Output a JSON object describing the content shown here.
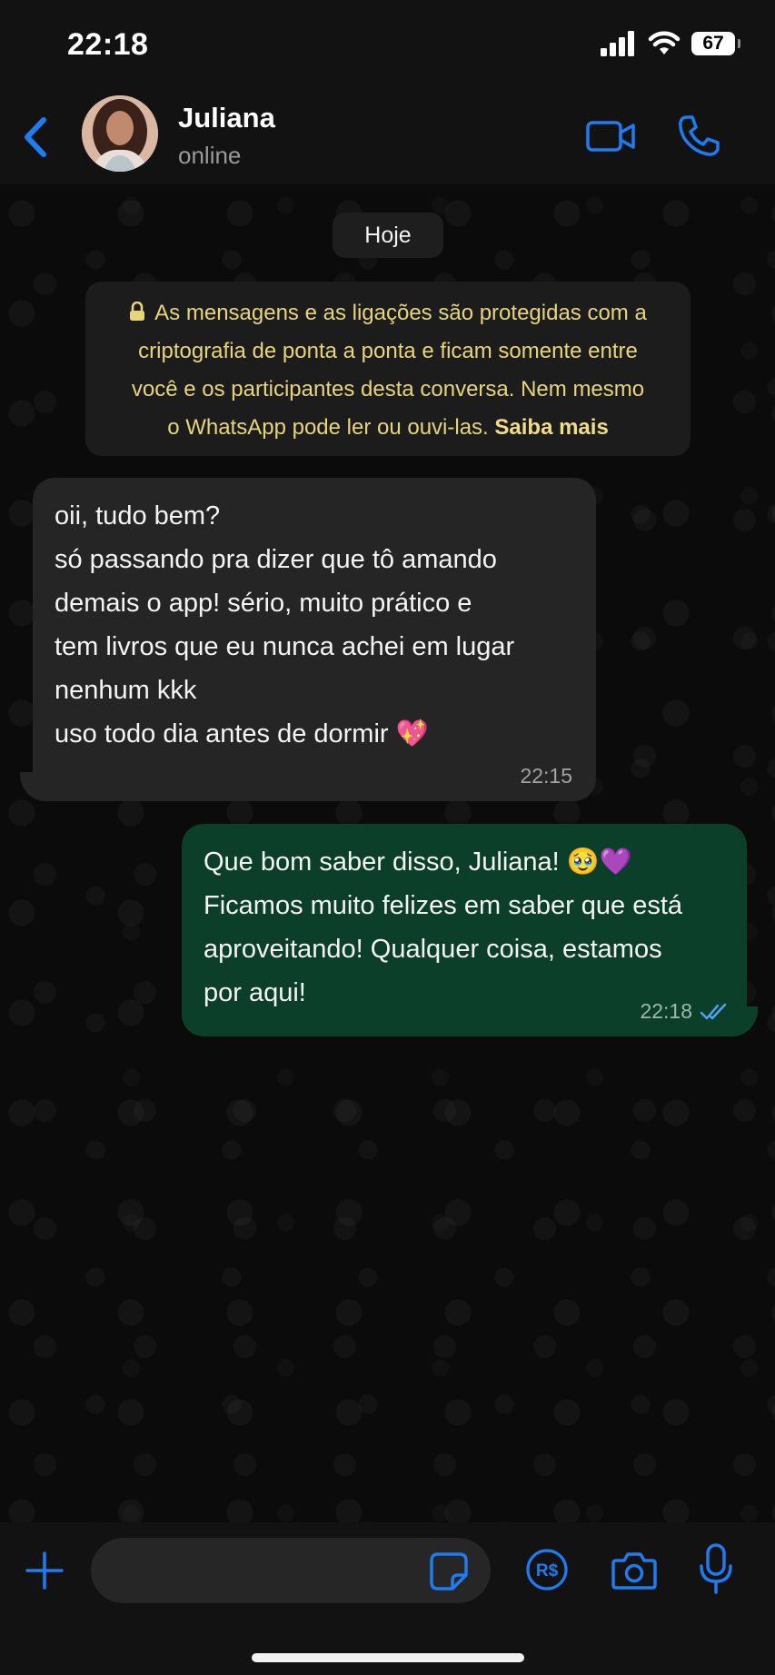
{
  "status_bar": {
    "time": "22:18",
    "battery": "67",
    "icons": [
      "cellular-signal-icon",
      "wifi-icon",
      "battery-icon"
    ]
  },
  "header": {
    "contact_name": "Juliana",
    "contact_status": "online",
    "icons": [
      "chevron-left-icon",
      "avatar",
      "video-camera-icon",
      "phone-icon"
    ]
  },
  "chat": {
    "date_label": "Hoje",
    "encryption_notice": {
      "text": "As mensagens e as ligações são protegidas com a criptografia de ponta a ponta e ficam somente entre você e os participantes desta conversa. Nem mesmo o WhatsApp pode ler ou ouvi-las.",
      "lines": [
        "As mensagens e as ligações são protegidas com a",
        "criptografia de ponta a ponta e ficam somente entre",
        "você e os participantes desta conversa. Nem mesmo",
        "o WhatsApp pode ler ou ouvi-las."
      ],
      "link": "Saiba mais",
      "icon": "lock-icon"
    },
    "messages": [
      {
        "direction": "incoming",
        "lines": [
          "oii, tudo bem?",
          "só passando pra dizer que tô amando",
          "demais o app! sério, muito prático e",
          "tem livros que eu nunca achei em lugar",
          "nenhum kkk",
          "uso todo dia antes de dormir 💖"
        ],
        "time": "22:15"
      },
      {
        "direction": "outgoing",
        "lines": [
          "Que bom saber disso, Juliana! 🥹💜",
          "Ficamos muito felizes em saber que está",
          "aproveitando! Qualquer coisa, estamos",
          "por aqui!"
        ],
        "time": "22:18",
        "status": "read"
      }
    ]
  },
  "input_bar": {
    "message_value": "",
    "icons": [
      "plus-icon",
      "sticker-icon",
      "payment-icon",
      "camera-icon",
      "microphone-icon"
    ],
    "payment_label": "R$"
  },
  "colors": {
    "accent": "#1f7bf0",
    "incoming_bubble": "#252525",
    "outgoing_bubble": "#0b3f2a",
    "notice_text": "#e7d57a",
    "background": "#0b0b0b"
  }
}
